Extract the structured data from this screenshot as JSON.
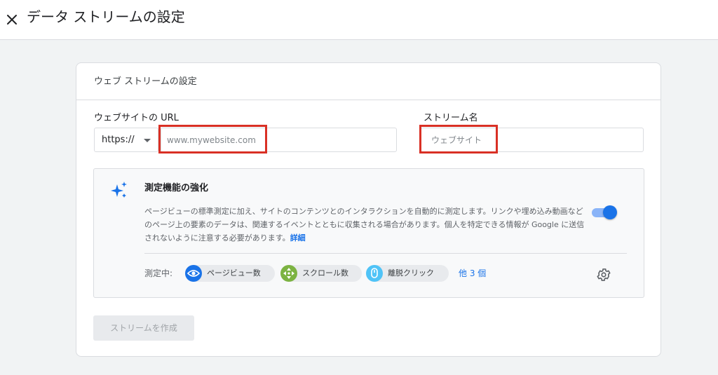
{
  "header": {
    "title": "データ ストリームの設定"
  },
  "card": {
    "title": "ウェブ ストリームの設定",
    "url_label": "ウェブサイトの URL",
    "protocol_value": "https://",
    "url_placeholder": "www.mywebsite.com",
    "name_label": "ストリーム名",
    "name_placeholder": "ウェブサイト"
  },
  "enhanced_measurement": {
    "title": "測定機能の強化",
    "description": "ページビューの標準測定に加え、サイトのコンテンツとのインタラクションを自動的に測定します。リンクや埋め込み動画などのページ上の要素のデータは、関連するイベントとともに収集される場合があります。個人を特定できる情報が Google に送信されないように注意する必要があります。",
    "details_link": "詳細",
    "toggle_on": true,
    "measuring_label": "測定中:",
    "chips": [
      {
        "label": "ページビュー数",
        "icon": "eye-icon",
        "color": "#1a73e8"
      },
      {
        "label": "スクロール数",
        "icon": "scroll-icon",
        "color": "#7cb342"
      },
      {
        "label": "離脱クリック",
        "icon": "mouse-icon",
        "color": "#4fc3f7"
      }
    ],
    "more_link": "他 3 個"
  },
  "actions": {
    "create_label": "ストリームを作成"
  },
  "colors": {
    "accent": "#1a73e8",
    "highlight_box": "#d93025"
  }
}
